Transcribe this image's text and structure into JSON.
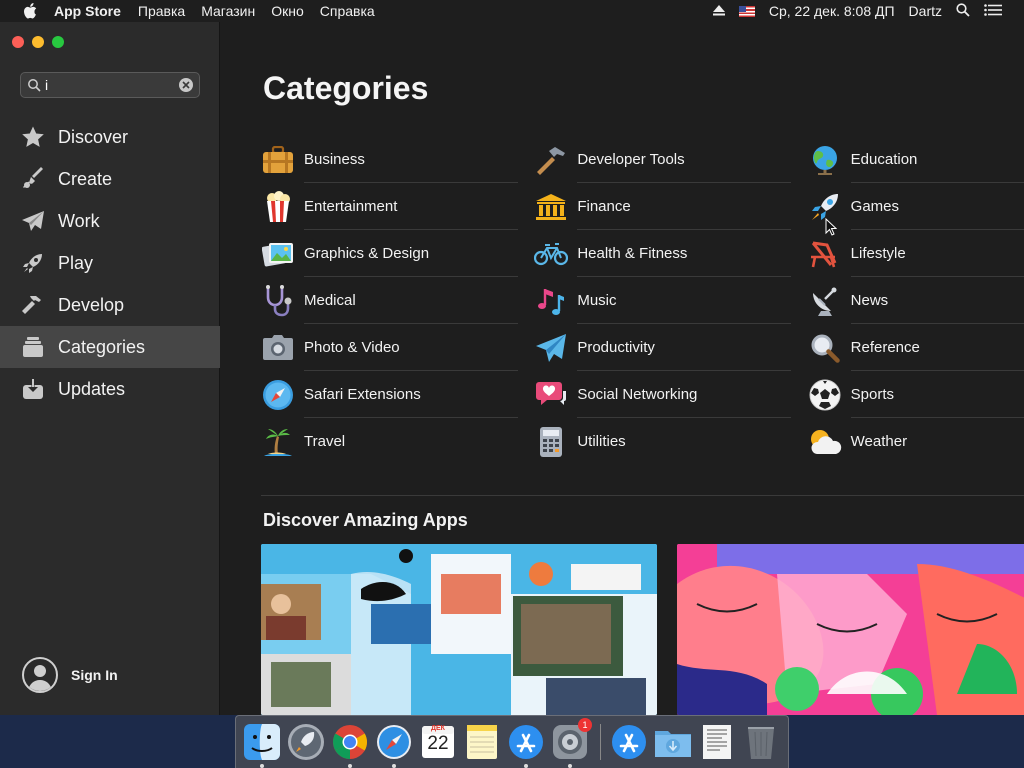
{
  "menubar": {
    "app_name": "App Store",
    "menus": [
      "Правка",
      "Магазин",
      "Окно",
      "Справка"
    ],
    "datetime": "Ср, 22 дек.  8:08 ДП",
    "user": "Dartz"
  },
  "search": {
    "value": "i"
  },
  "sidebar": {
    "items": [
      {
        "label": "Discover",
        "icon": "star-icon"
      },
      {
        "label": "Create",
        "icon": "brush-icon"
      },
      {
        "label": "Work",
        "icon": "paper-plane-icon"
      },
      {
        "label": "Play",
        "icon": "rocket-icon"
      },
      {
        "label": "Develop",
        "icon": "hammer-icon"
      },
      {
        "label": "Categories",
        "icon": "stack-icon",
        "active": true
      },
      {
        "label": "Updates",
        "icon": "download-icon"
      }
    ],
    "sign_in": "Sign In"
  },
  "main": {
    "title": "Categories",
    "categories": [
      {
        "label": "Business",
        "icon": "briefcase-icon"
      },
      {
        "label": "Developer Tools",
        "icon": "hammer-icon"
      },
      {
        "label": "Education",
        "icon": "globe-icon"
      },
      {
        "label": "Entertainment",
        "icon": "popcorn-icon"
      },
      {
        "label": "Finance",
        "icon": "bank-icon"
      },
      {
        "label": "Games",
        "icon": "rocket-icon"
      },
      {
        "label": "Graphics & Design",
        "icon": "picture-icon"
      },
      {
        "label": "Health & Fitness",
        "icon": "bicycle-icon"
      },
      {
        "label": "Lifestyle",
        "icon": "beach-chair-icon"
      },
      {
        "label": "Medical",
        "icon": "stethoscope-icon"
      },
      {
        "label": "Music",
        "icon": "music-notes-icon"
      },
      {
        "label": "News",
        "icon": "satellite-dish-icon"
      },
      {
        "label": "Photo & Video",
        "icon": "camera-icon"
      },
      {
        "label": "Productivity",
        "icon": "paper-plane-icon"
      },
      {
        "label": "Reference",
        "icon": "magnifier-icon"
      },
      {
        "label": "Safari Extensions",
        "icon": "compass-icon"
      },
      {
        "label": "Social Networking",
        "icon": "chat-heart-icon"
      },
      {
        "label": "Sports",
        "icon": "soccer-ball-icon"
      },
      {
        "label": "Travel",
        "icon": "palm-tree-icon"
      },
      {
        "label": "Utilities",
        "icon": "calculator-icon"
      },
      {
        "label": "Weather",
        "icon": "sun-cloud-icon"
      }
    ],
    "section_title": "Discover Amazing Apps"
  },
  "dock": {
    "items": [
      "Finder",
      "Launchpad",
      "Google Chrome",
      "Safari",
      "Calendar",
      "Notes",
      "App Store",
      "System Preferences",
      "Applications",
      "Downloads",
      "Document",
      "Trash"
    ],
    "calendar": {
      "month": "ДЕК",
      "day": "22"
    },
    "system_preferences_badge": "1"
  },
  "colors": {
    "sidebar_bg": "#2b2b2b",
    "main_bg": "#1e1e1e",
    "active_item_bg": "#464646",
    "divider": "#3a3a3a"
  }
}
